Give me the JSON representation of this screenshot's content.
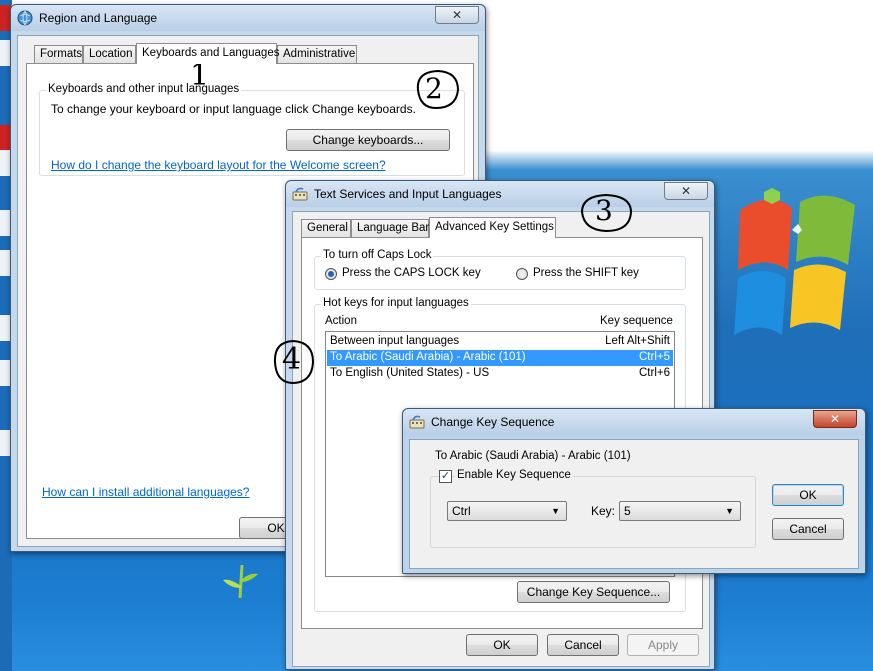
{
  "colors": {
    "link": "#0066cc",
    "selection": "#3399ff",
    "titlebar": "#c5d8ec",
    "close_red": "#c4432a"
  },
  "region_window": {
    "title": "Region and Language",
    "icon": "globe-icon",
    "close": "✕",
    "tabs": [
      "Formats",
      "Location",
      "Keyboards and Languages",
      "Administrative"
    ],
    "active_tab": "Keyboards and Languages",
    "group_label": "Keyboards and other input languages",
    "group_text": "To change your keyboard or input language click Change keyboards.",
    "change_keyboards_button": "Change keyboards...",
    "welcome_link": "How do I change the keyboard layout for the Welcome screen?",
    "install_link": "How can I install additional languages?",
    "ok_button": "OK"
  },
  "text_services_window": {
    "title": "Text Services and Input Languages",
    "icon": "keyboard-icon",
    "close": "✕",
    "tabs": [
      "General",
      "Language Bar",
      "Advanced Key Settings"
    ],
    "active_tab": "Advanced Key Settings",
    "caps_group_label": "To turn off Caps Lock",
    "radio_caps": "Press the CAPS LOCK key",
    "radio_shift": "Press the SHIFT key",
    "hotkeys_group_label": "Hot keys for input languages",
    "columns": {
      "action": "Action",
      "sequence": "Key sequence"
    },
    "rows": [
      {
        "action": "Between input languages",
        "sequence": "Left Alt+Shift"
      },
      {
        "action": "To Arabic (Saudi Arabia) - Arabic (101)",
        "sequence": "Ctrl+5"
      },
      {
        "action": "To English (United States) - US",
        "sequence": "Ctrl+6"
      }
    ],
    "selected_row": 1,
    "change_sequence_button": "Change Key Sequence...",
    "ok_button": "OK",
    "cancel_button": "Cancel",
    "apply_button": "Apply"
  },
  "change_key_dialog": {
    "title": "Change Key Sequence",
    "icon": "keyboard-icon",
    "close": "✕",
    "target_label": "To Arabic (Saudi Arabia) - Arabic (101)",
    "enable_label": "Enable Key Sequence",
    "enable_checked": true,
    "modifier_value": "Ctrl",
    "key_label": "Key:",
    "key_value": "5",
    "ok_button": "OK",
    "cancel_button": "Cancel"
  },
  "annotations": [
    "1",
    "2",
    "3",
    "4"
  ]
}
